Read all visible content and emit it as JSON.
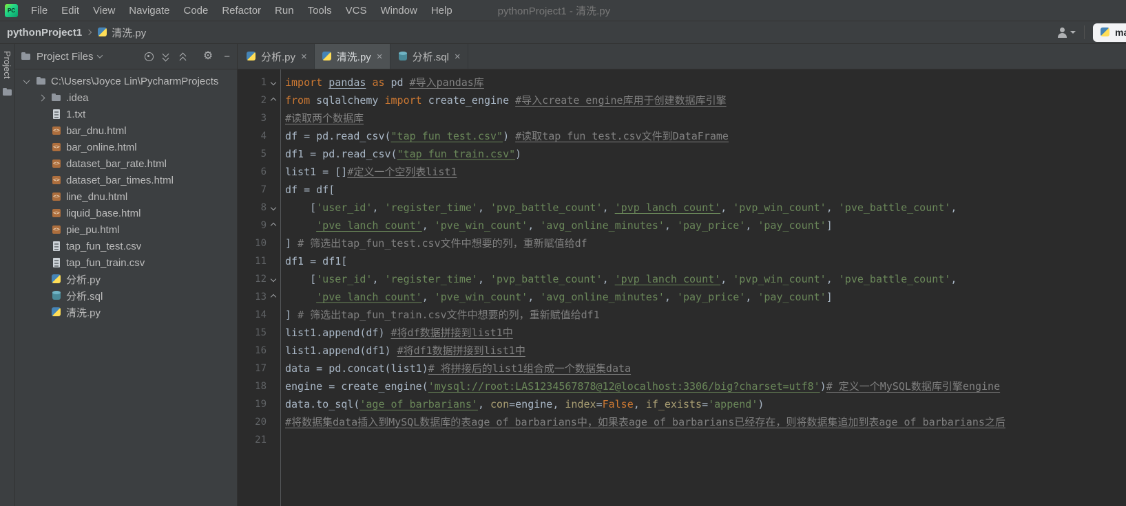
{
  "window": {
    "title": "pythonProject1 - 清洗.py"
  },
  "menubar": {
    "items": [
      "File",
      "Edit",
      "View",
      "Navigate",
      "Code",
      "Refactor",
      "Run",
      "Tools",
      "VCS",
      "Window",
      "Help"
    ]
  },
  "breadcrumbs": {
    "project": "pythonProject1",
    "file": "清洗.py"
  },
  "run_widget": {
    "config_name": "main"
  },
  "tool_windows": {
    "left_label": "Project"
  },
  "project_panel": {
    "title": "Project Files",
    "tree": [
      {
        "label": "C:\\Users\\Joyce Lin\\PycharmProjects",
        "icon": "folder",
        "level": 0,
        "chevron": "down"
      },
      {
        "label": ".idea",
        "icon": "folder",
        "level": 1,
        "chevron": "right"
      },
      {
        "label": "1.txt",
        "icon": "text",
        "level": 1
      },
      {
        "label": "bar_dnu.html",
        "icon": "html",
        "level": 1
      },
      {
        "label": "bar_online.html",
        "icon": "html",
        "level": 1
      },
      {
        "label": "dataset_bar_rate.html",
        "icon": "html",
        "level": 1
      },
      {
        "label": "dataset_bar_times.html",
        "icon": "html",
        "level": 1
      },
      {
        "label": "line_dnu.html",
        "icon": "html",
        "level": 1
      },
      {
        "label": "liquid_base.html",
        "icon": "html",
        "level": 1
      },
      {
        "label": "pie_pu.html",
        "icon": "html",
        "level": 1
      },
      {
        "label": "tap_fun_test.csv",
        "icon": "text",
        "level": 1
      },
      {
        "label": "tap_fun_train.csv",
        "icon": "text",
        "level": 1
      },
      {
        "label": "分析.py",
        "icon": "python",
        "level": 1
      },
      {
        "label": "分析.sql",
        "icon": "sql",
        "level": 1
      },
      {
        "label": "清洗.py",
        "icon": "python",
        "level": 1
      }
    ]
  },
  "editor": {
    "tabs": [
      {
        "label": "分析.py",
        "icon": "python",
        "active": false
      },
      {
        "label": "清洗.py",
        "icon": "python",
        "active": true
      },
      {
        "label": "分析.sql",
        "icon": "sql",
        "active": false
      }
    ],
    "lines": [
      {
        "n": 1,
        "fold": "down",
        "s": [
          {
            "t": "import",
            "c": "kw"
          },
          {
            "t": " "
          },
          {
            "t": "pandas",
            "u": true
          },
          {
            "t": " "
          },
          {
            "t": "as",
            "c": "kw"
          },
          {
            "t": " pd "
          },
          {
            "t": "#导入pandas库",
            "c": "com",
            "u": true
          }
        ]
      },
      {
        "n": 2,
        "fold": "up",
        "s": [
          {
            "t": "from",
            "c": "kw"
          },
          {
            "t": " sqlalchemy "
          },
          {
            "t": "import",
            "c": "kw"
          },
          {
            "t": " create_engine "
          },
          {
            "t": "#导入create_engine库用于创建数据库引擎",
            "c": "com",
            "u": true
          }
        ]
      },
      {
        "n": 3,
        "s": [
          {
            "t": "#读取两个数据库",
            "c": "com",
            "u": true
          }
        ]
      },
      {
        "n": 4,
        "s": [
          {
            "t": "df = pd.read_csv("
          },
          {
            "t": "\"tap_fun_test.csv\"",
            "c": "str",
            "u": true
          },
          {
            "t": ") "
          },
          {
            "t": "#读取tap_fun_test.csv文件到DataFrame",
            "c": "com",
            "u": true
          }
        ]
      },
      {
        "n": 5,
        "s": [
          {
            "t": "df1 = pd.read_csv("
          },
          {
            "t": "\"tap_fun_train.csv\"",
            "c": "str",
            "u": true
          },
          {
            "t": ")"
          }
        ]
      },
      {
        "n": 6,
        "s": [
          {
            "t": "list1 = []"
          },
          {
            "t": "#定义一个空列表list1",
            "c": "com",
            "u": true
          }
        ]
      },
      {
        "n": 7,
        "s": [
          {
            "t": "df = df["
          }
        ]
      },
      {
        "n": 8,
        "fold": "down",
        "s": [
          {
            "t": "    ["
          },
          {
            "t": "'user_id'",
            "c": "str"
          },
          {
            "t": ", "
          },
          {
            "t": "'register_time'",
            "c": "str"
          },
          {
            "t": ", "
          },
          {
            "t": "'pvp_battle_count'",
            "c": "str"
          },
          {
            "t": ", "
          },
          {
            "t": "'pvp_lanch_count'",
            "c": "str",
            "u": true
          },
          {
            "t": ", "
          },
          {
            "t": "'pvp_win_count'",
            "c": "str"
          },
          {
            "t": ", "
          },
          {
            "t": "'pve_battle_count'",
            "c": "str"
          },
          {
            "t": ","
          }
        ]
      },
      {
        "n": 9,
        "fold": "up",
        "s": [
          {
            "t": "     "
          },
          {
            "t": "'pve_lanch_count'",
            "c": "str",
            "u": true
          },
          {
            "t": ", "
          },
          {
            "t": "'pve_win_count'",
            "c": "str"
          },
          {
            "t": ", "
          },
          {
            "t": "'avg_online_minutes'",
            "c": "str"
          },
          {
            "t": ", "
          },
          {
            "t": "'pay_price'",
            "c": "str"
          },
          {
            "t": ", "
          },
          {
            "t": "'pay_count'",
            "c": "str"
          },
          {
            "t": "]"
          }
        ]
      },
      {
        "n": 10,
        "s": [
          {
            "t": "] "
          },
          {
            "t": "# 筛选出tap_fun_test.csv文件中想要的列，重新赋值给df",
            "c": "com"
          }
        ]
      },
      {
        "n": 11,
        "s": [
          {
            "t": "df1 = df1["
          }
        ]
      },
      {
        "n": 12,
        "fold": "down",
        "s": [
          {
            "t": "    ["
          },
          {
            "t": "'user_id'",
            "c": "str"
          },
          {
            "t": ", "
          },
          {
            "t": "'register_time'",
            "c": "str"
          },
          {
            "t": ", "
          },
          {
            "t": "'pvp_battle_count'",
            "c": "str"
          },
          {
            "t": ", "
          },
          {
            "t": "'pvp_lanch_count'",
            "c": "str",
            "u": true
          },
          {
            "t": ", "
          },
          {
            "t": "'pvp_win_count'",
            "c": "str"
          },
          {
            "t": ", "
          },
          {
            "t": "'pve_battle_count'",
            "c": "str"
          },
          {
            "t": ","
          }
        ]
      },
      {
        "n": 13,
        "fold": "up",
        "s": [
          {
            "t": "     "
          },
          {
            "t": "'pve_lanch_count'",
            "c": "str",
            "u": true
          },
          {
            "t": ", "
          },
          {
            "t": "'pve_win_count'",
            "c": "str"
          },
          {
            "t": ", "
          },
          {
            "t": "'avg_online_minutes'",
            "c": "str"
          },
          {
            "t": ", "
          },
          {
            "t": "'pay_price'",
            "c": "str"
          },
          {
            "t": ", "
          },
          {
            "t": "'pay_count'",
            "c": "str"
          },
          {
            "t": "]"
          }
        ]
      },
      {
        "n": 14,
        "s": [
          {
            "t": "] "
          },
          {
            "t": "# 筛选出tap_fun_train.csv文件中想要的列，重新赋值给df1",
            "c": "com"
          }
        ]
      },
      {
        "n": 15,
        "s": [
          {
            "t": "list1.append(df) "
          },
          {
            "t": "#将df数据拼接到list1中",
            "c": "com",
            "u": true
          }
        ]
      },
      {
        "n": 16,
        "s": [
          {
            "t": "list1.append(df1) "
          },
          {
            "t": "#将df1数据拼接到list1中",
            "c": "com",
            "u": true
          }
        ]
      },
      {
        "n": 17,
        "s": [
          {
            "t": "data = pd.concat(list1)"
          },
          {
            "t": "# 将拼接后的list1组合成一个数据集data",
            "c": "com",
            "u": true
          }
        ]
      },
      {
        "n": 18,
        "s": [
          {
            "t": "engine = create_engine("
          },
          {
            "t": "'mysql://root:LAS1234567878@12@localhost:3306/big?charset=utf8'",
            "c": "str",
            "u": true
          },
          {
            "t": ")"
          },
          {
            "t": "# 定义一个MySQL数据库引擎engine",
            "c": "com",
            "u": true
          }
        ]
      },
      {
        "n": 19,
        "s": [
          {
            "t": "data.to_sql("
          },
          {
            "t": "'age_of_barbarians'",
            "c": "str",
            "u": true
          },
          {
            "t": ", "
          },
          {
            "t": "con",
            "c": "named"
          },
          {
            "t": "=engine, "
          },
          {
            "t": "index",
            "c": "named"
          },
          {
            "t": "="
          },
          {
            "t": "False",
            "c": "kw"
          },
          {
            "t": ", "
          },
          {
            "t": "if_exists",
            "c": "named"
          },
          {
            "t": "="
          },
          {
            "t": "'append'",
            "c": "str"
          },
          {
            "t": ")"
          }
        ]
      },
      {
        "n": 20,
        "s": [
          {
            "t": "#将数据集data插入到MySQL数据库的表age_of_barbarians中，如果表age_of_barbarians已经存在，则将数据集追加到表age_of_barbarians之后",
            "c": "com",
            "u": true
          }
        ]
      },
      {
        "n": 21,
        "s": []
      }
    ]
  },
  "colors": {
    "editor_background": "#2b2b2b",
    "panel_background": "#3c3f41",
    "keyword": "#cc7832",
    "string": "#6a8759",
    "comment": "#808080",
    "named_argument": "#aa9f73",
    "text": "#a9b7c6",
    "line_number": "#606366"
  }
}
